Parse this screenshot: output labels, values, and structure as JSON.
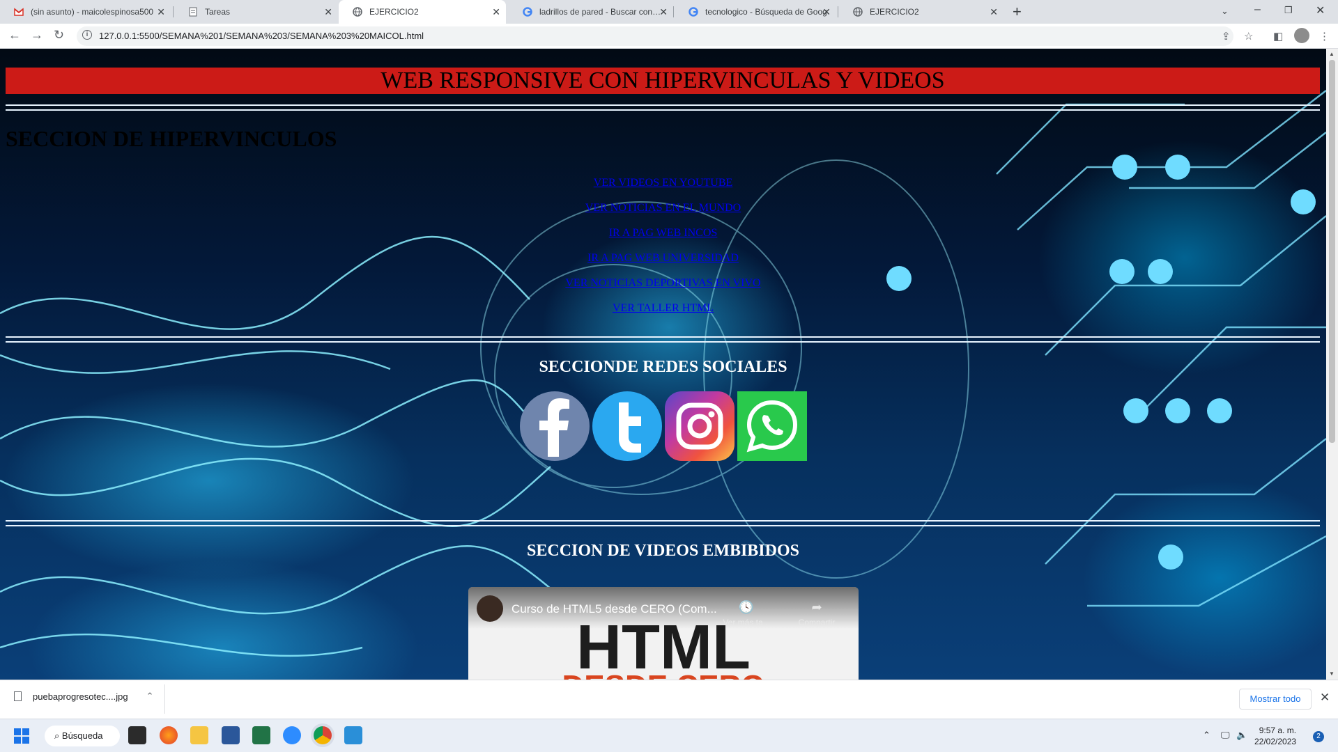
{
  "browser": {
    "tabs": [
      {
        "title": "(sin asunto) - maicolespinosa500",
        "icon": "gmail-icon"
      },
      {
        "title": "Tareas",
        "icon": "document-icon"
      },
      {
        "title": "EJERCICIO2",
        "icon": "globe-icon",
        "active": true
      },
      {
        "title": "ladrillos de pared - Buscar con Go",
        "icon": "google-icon"
      },
      {
        "title": "tecnologico - Búsqueda de Goog",
        "icon": "google-icon"
      },
      {
        "title": "EJERCICIO2",
        "icon": "globe-icon"
      }
    ],
    "url": "127.0.0.1:5500/SEMANA%201/SEMANA%203/SEMANA%203%20MAICOL.html"
  },
  "page": {
    "title": "WEB RESPONSIVE CON HIPERVINCULAS Y VIDEOS",
    "links_heading": "SECCION DE HIPERVINCULOS",
    "links": [
      "VER VIDEOS EN YOUTUBE",
      "VER NOTICIAS EN EL MUNDO",
      "IR A PAG WEB INCOS",
      "IR A PAG WEB UNIVERSIDAD",
      "VER NOTICIAS DEPORTIVAS EN VIVO",
      "VER TALLER HTML"
    ],
    "social_heading": "SECCIONDE REDES SOCIALES",
    "social": [
      {
        "name": "facebook",
        "letter": "f"
      },
      {
        "name": "twitter",
        "letter": "t"
      },
      {
        "name": "instagram",
        "letter": ""
      },
      {
        "name": "whatsapp",
        "letter": ""
      }
    ],
    "video_heading": "SECCION DE VIDEOS EMBIBIDOS",
    "video": {
      "title": "Curso de HTML5 desde CERO (Com...",
      "watch_later": "Ver más ta...",
      "share": "Compartir",
      "big_text": "HTML",
      "sub_text": "DESDE CERO"
    }
  },
  "downloads": {
    "file": "puebaprogresotec....jpg",
    "show_all": "Mostrar todo"
  },
  "taskbar": {
    "search": "Búsqueda",
    "time": "9:57 a. m.",
    "date": "22/02/2023",
    "notifications": "2"
  }
}
